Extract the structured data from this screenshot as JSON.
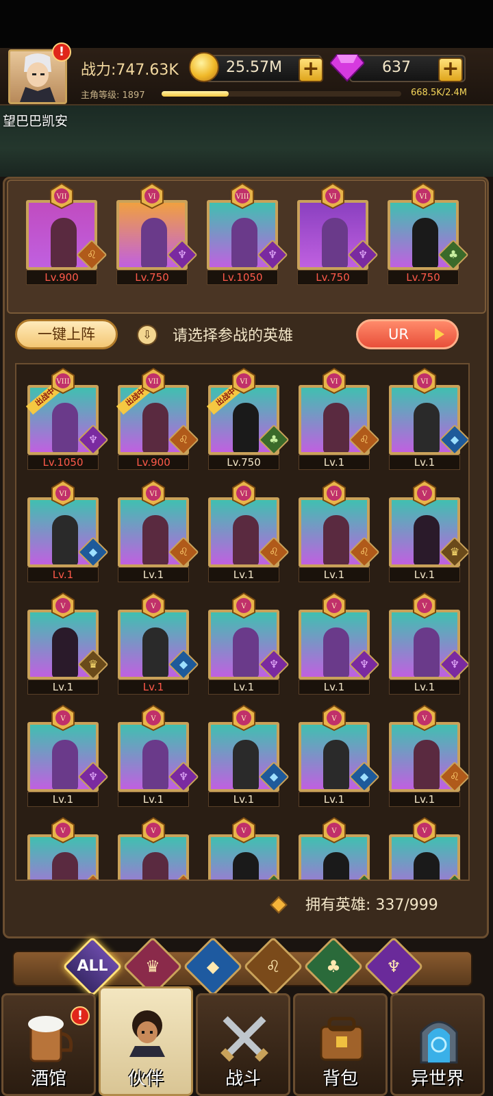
{
  "header": {
    "power": "战力:747.63K",
    "level_label": "主角等级: 1897",
    "xp_text": "668.5K/2.4M",
    "xp_fraction": 0.28,
    "coins": "25.57M",
    "gems": "637",
    "plus": "+",
    "alert": "!",
    "username": "望巴巴凯安"
  },
  "team": [
    {
      "rank": "VII",
      "level": "Lv.900",
      "color": "#c04cc0",
      "faction": "lion"
    },
    {
      "rank": "VI",
      "level": "Lv.750",
      "color": "#f0a040",
      "faction": "demon"
    },
    {
      "rank": "VIII",
      "level": "Lv.1050",
      "color": "#40c0b0",
      "faction": "demon"
    },
    {
      "rank": "VI",
      "level": "Lv.750",
      "color": "#8a40c0",
      "faction": "demon"
    },
    {
      "rank": "VI",
      "level": "Lv.750",
      "color": "#40c0b0",
      "faction": "elf"
    }
  ],
  "controls": {
    "deploy_button": "一键上阵",
    "hint": "请选择参战的英雄",
    "hint_icon": "⇩",
    "ur_button": "UR"
  },
  "heroes": [
    {
      "rank": "VIII",
      "level": "Lv.1050",
      "level_color": "red",
      "faction": "demon",
      "deployed": true
    },
    {
      "rank": "VII",
      "level": "Lv.900",
      "level_color": "red",
      "faction": "lion",
      "deployed": true
    },
    {
      "rank": "VI",
      "level": "Lv.750",
      "level_color": "white",
      "faction": "elf",
      "deployed": true
    },
    {
      "rank": "VI",
      "level": "Lv.1",
      "level_color": "white",
      "faction": "lion",
      "deployed": false
    },
    {
      "rank": "VI",
      "level": "Lv.1",
      "level_color": "white",
      "faction": "fish",
      "deployed": false
    },
    {
      "rank": "VI",
      "level": "Lv.1",
      "level_color": "red",
      "faction": "fish",
      "deployed": false
    },
    {
      "rank": "VI",
      "level": "Lv.1",
      "level_color": "white",
      "faction": "lion",
      "deployed": false
    },
    {
      "rank": "VI",
      "level": "Lv.1",
      "level_color": "white",
      "faction": "lion",
      "deployed": false
    },
    {
      "rank": "VI",
      "level": "Lv.1",
      "level_color": "white",
      "faction": "lion",
      "deployed": false
    },
    {
      "rank": "V",
      "level": "Lv.1",
      "level_color": "white",
      "faction": "knight",
      "deployed": false
    },
    {
      "rank": "V",
      "level": "Lv.1",
      "level_color": "white",
      "faction": "knight",
      "deployed": false
    },
    {
      "rank": "V",
      "level": "Lv.1",
      "level_color": "red",
      "faction": "fish",
      "deployed": false
    },
    {
      "rank": "V",
      "level": "Lv.1",
      "level_color": "white",
      "faction": "demon",
      "deployed": false
    },
    {
      "rank": "V",
      "level": "Lv.1",
      "level_color": "white",
      "faction": "demon",
      "deployed": false
    },
    {
      "rank": "V",
      "level": "Lv.1",
      "level_color": "white",
      "faction": "demon",
      "deployed": false
    },
    {
      "rank": "V",
      "level": "Lv.1",
      "level_color": "white",
      "faction": "demon",
      "deployed": false
    },
    {
      "rank": "V",
      "level": "Lv.1",
      "level_color": "white",
      "faction": "demon",
      "deployed": false
    },
    {
      "rank": "V",
      "level": "Lv.1",
      "level_color": "white",
      "faction": "fish",
      "deployed": false
    },
    {
      "rank": "V",
      "level": "Lv.1",
      "level_color": "white",
      "faction": "fish",
      "deployed": false
    },
    {
      "rank": "V",
      "level": "Lv.1",
      "level_color": "white",
      "faction": "lion",
      "deployed": false
    },
    {
      "rank": "V",
      "level": "",
      "level_color": "white",
      "faction": "lion",
      "deployed": false
    },
    {
      "rank": "V",
      "level": "",
      "level_color": "white",
      "faction": "lion",
      "deployed": false
    },
    {
      "rank": "V",
      "level": "",
      "level_color": "white",
      "faction": "elf",
      "deployed": false
    },
    {
      "rank": "V",
      "level": "",
      "level_color": "white",
      "faction": "elf",
      "deployed": false
    },
    {
      "rank": "V",
      "level": "",
      "level_color": "white",
      "faction": "elf",
      "deployed": false
    }
  ],
  "deployed_ribbon": "出战中",
  "owned": {
    "text": "拥有英雄: 337/999"
  },
  "filters": [
    {
      "id": "all",
      "label": "ALL"
    },
    {
      "id": "knight",
      "label": "♛"
    },
    {
      "id": "fish",
      "label": "◆"
    },
    {
      "id": "lion",
      "label": "♌"
    },
    {
      "id": "elf",
      "label": "♣"
    },
    {
      "id": "demon",
      "label": "♆"
    }
  ],
  "nav": [
    {
      "id": "tavern",
      "label": "酒馆",
      "alert": "!"
    },
    {
      "id": "partner",
      "label": "伙伴"
    },
    {
      "id": "battle",
      "label": "战斗"
    },
    {
      "id": "bag",
      "label": "背包"
    },
    {
      "id": "otherworld",
      "label": "异世界"
    }
  ]
}
